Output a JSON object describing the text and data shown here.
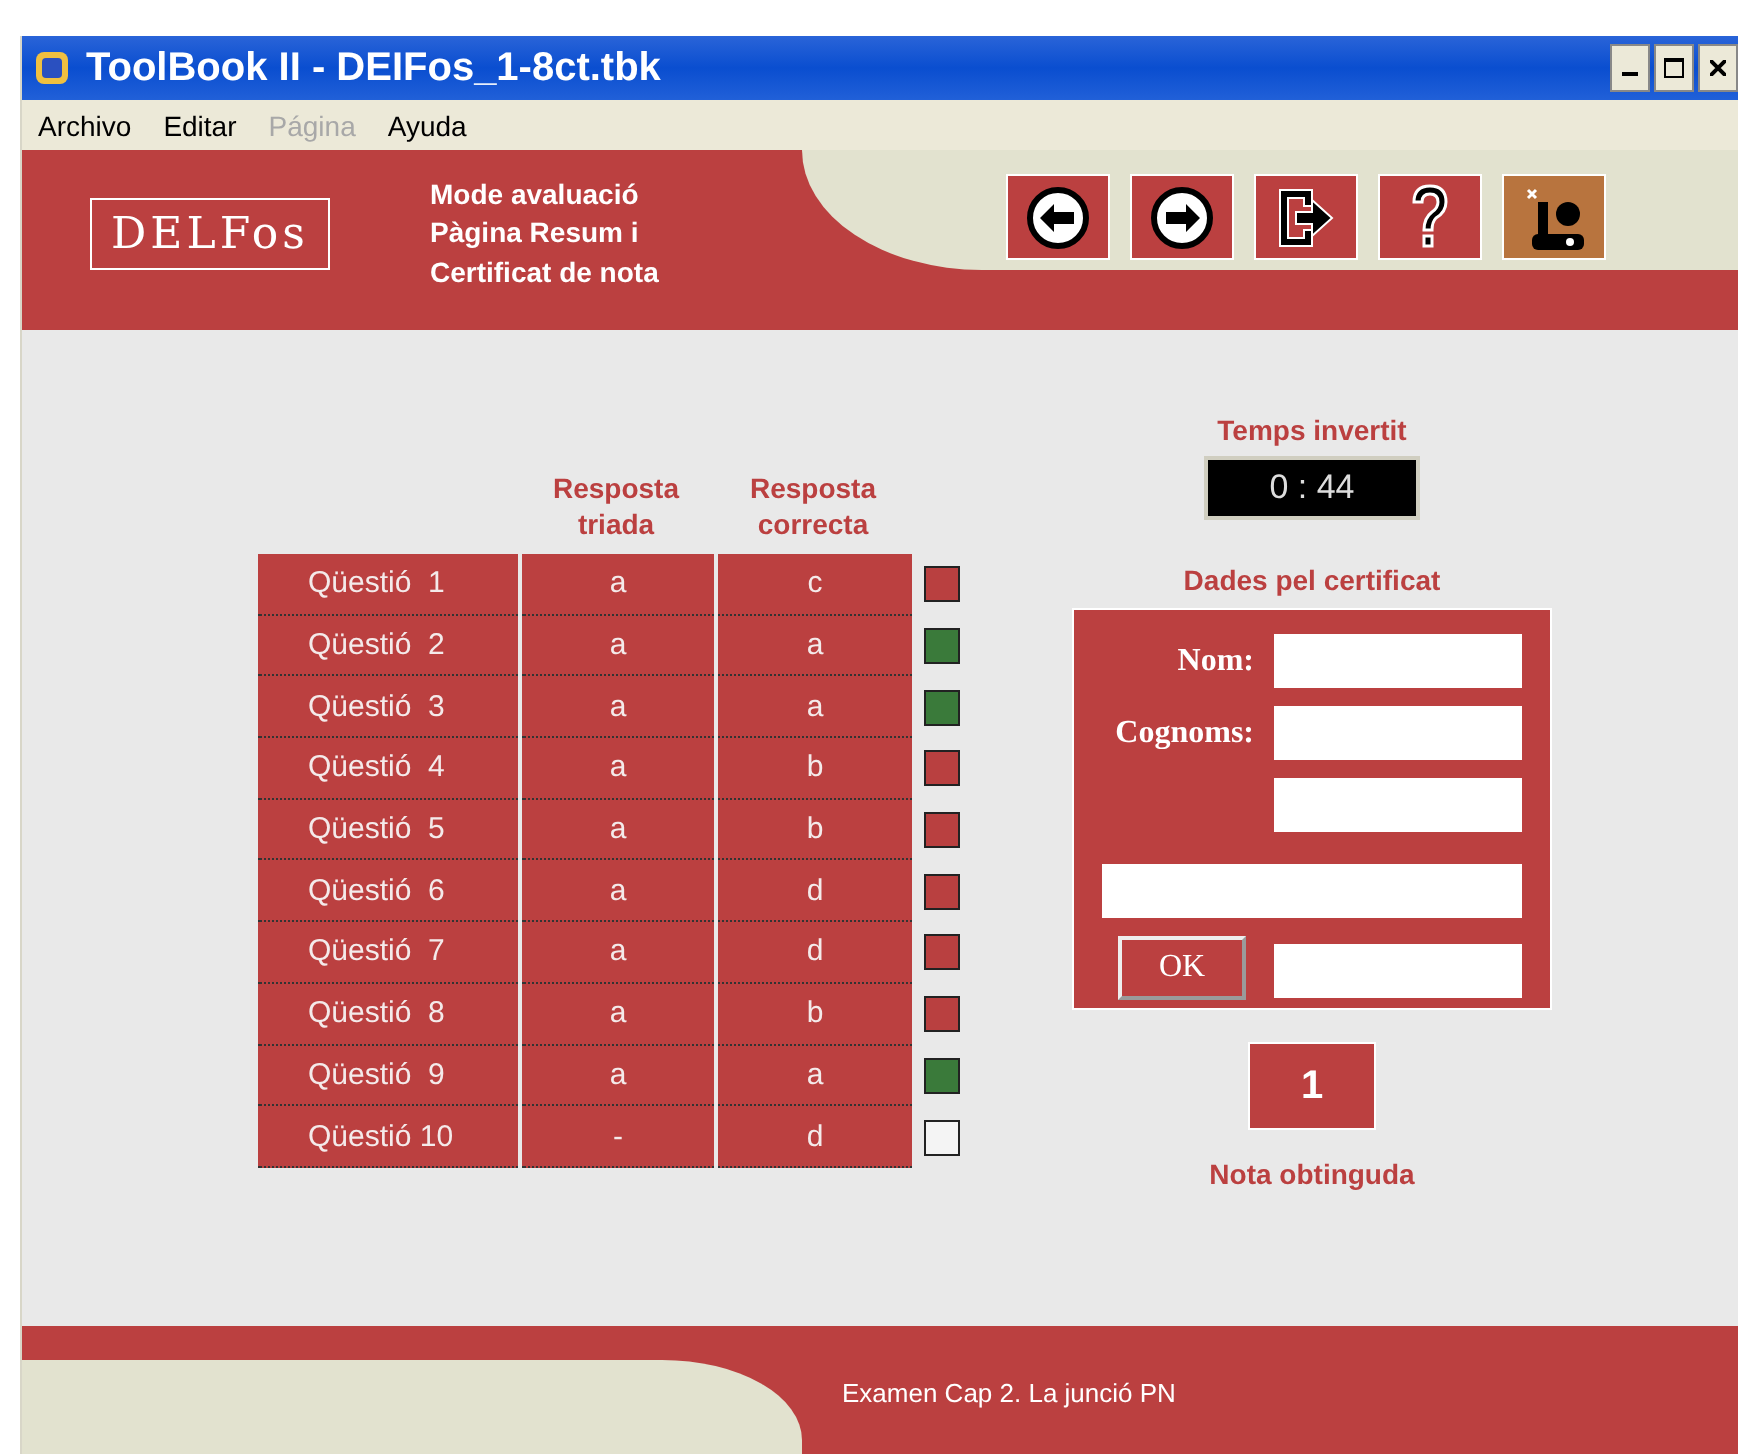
{
  "window": {
    "title": "ToolBook II - DEIFos_1-8ct.tbk"
  },
  "menu": [
    {
      "label": "Archivo",
      "disabled": false
    },
    {
      "label": "Editar",
      "disabled": false
    },
    {
      "label": "Página",
      "disabled": true
    },
    {
      "label": "Ayuda",
      "disabled": false
    }
  ],
  "header": {
    "logo": "DELFos",
    "caption": [
      "Mode avaluació",
      "Pàgina Resum i",
      "Certificat de nota"
    ],
    "toolbar": [
      {
        "kind": "back"
      },
      {
        "kind": "forward"
      },
      {
        "kind": "exit"
      },
      {
        "kind": "help"
      },
      {
        "kind": "tools"
      }
    ]
  },
  "table": {
    "columns": [
      "",
      "Resposta triada",
      "Resposta correcta"
    ],
    "rows": [
      {
        "question": "Qüestió  1",
        "chosen": "a",
        "correct": "c",
        "color": "#b94040"
      },
      {
        "question": "Qüestió  2",
        "chosen": "a",
        "correct": "a",
        "color": "#3a7a3a"
      },
      {
        "question": "Qüestió  3",
        "chosen": "a",
        "correct": "a",
        "color": "#3a7a3a"
      },
      {
        "question": "Qüestió  4",
        "chosen": "a",
        "correct": "b",
        "color": "#b94040"
      },
      {
        "question": "Qüestió  5",
        "chosen": "a",
        "correct": "b",
        "color": "#b94040"
      },
      {
        "question": "Qüestió  6",
        "chosen": "a",
        "correct": "d",
        "color": "#b94040"
      },
      {
        "question": "Qüestió  7",
        "chosen": "a",
        "correct": "d",
        "color": "#b94040"
      },
      {
        "question": "Qüestió  8",
        "chosen": "a",
        "correct": "b",
        "color": "#b94040"
      },
      {
        "question": "Qüestió  9",
        "chosen": "a",
        "correct": "a",
        "color": "#3a7a3a"
      },
      {
        "question": "Qüestió 10",
        "chosen": "-",
        "correct": "d",
        "color": "#f4f4f4"
      }
    ]
  },
  "timer": {
    "label": "Temps invertit",
    "value": "0 : 44"
  },
  "certificate": {
    "title": "Dades pel certificat",
    "name_label": "Nom:",
    "surname_label": "Cognoms:",
    "ok_button": "OK"
  },
  "grade": {
    "value": "1",
    "label": "Nota obtinguda"
  },
  "footer": {
    "text": "Examen Cap 2. La junció PN"
  }
}
